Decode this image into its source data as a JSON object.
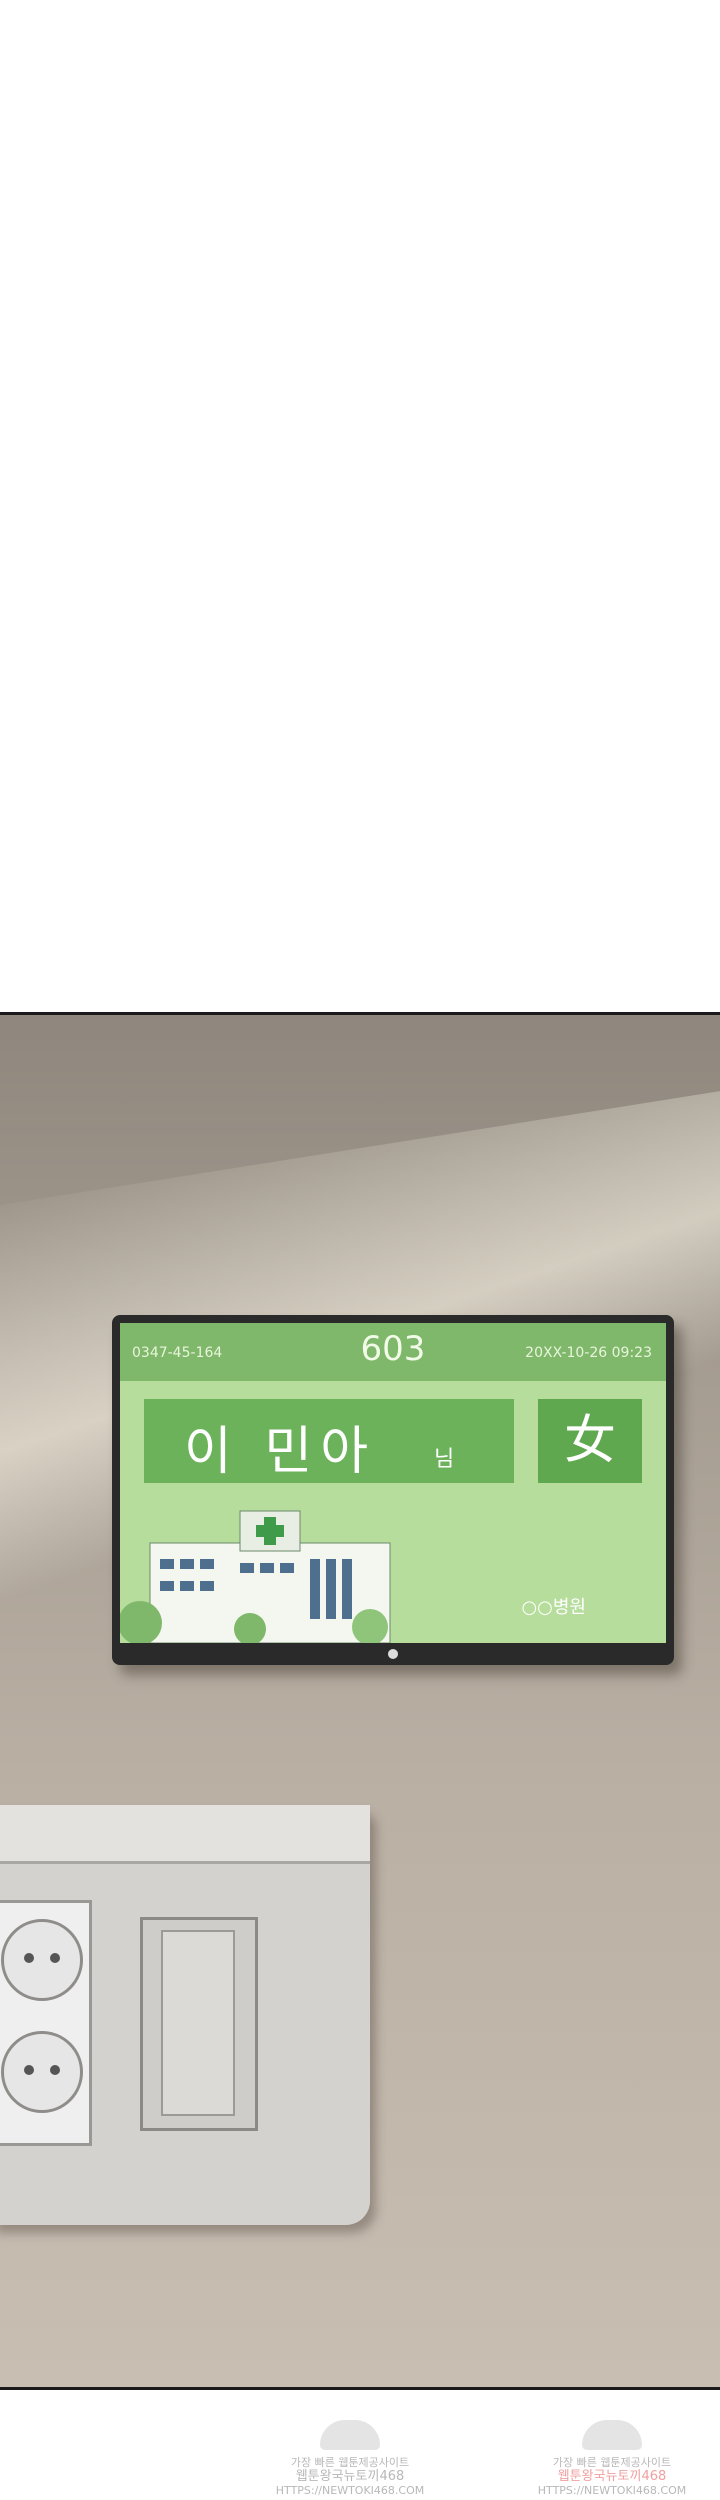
{
  "tv": {
    "id_number": "0347-45-164",
    "room": "603",
    "datetime": "20XX-10-26 09:23",
    "patient_name": "이 민아",
    "honorific": "님",
    "gender": "女",
    "hospital": "○○병원",
    "colors": {
      "screen": "#b7dd9c",
      "header": "#7fb86a",
      "name_box": "#6bb25a"
    }
  },
  "watermarks": [
    {
      "line1": "가장 빠른 웹툰제공사이트",
      "line2": "웹툰왕국뉴토끼468",
      "line3": "HTTPS://NEWTOKI468.COM"
    },
    {
      "line1": "가장 빠른 웹툰제공사이트",
      "line2": "웹툰왕국뉴토끼468",
      "line3": "HTTPS://NEWTOKI468.COM"
    }
  ]
}
